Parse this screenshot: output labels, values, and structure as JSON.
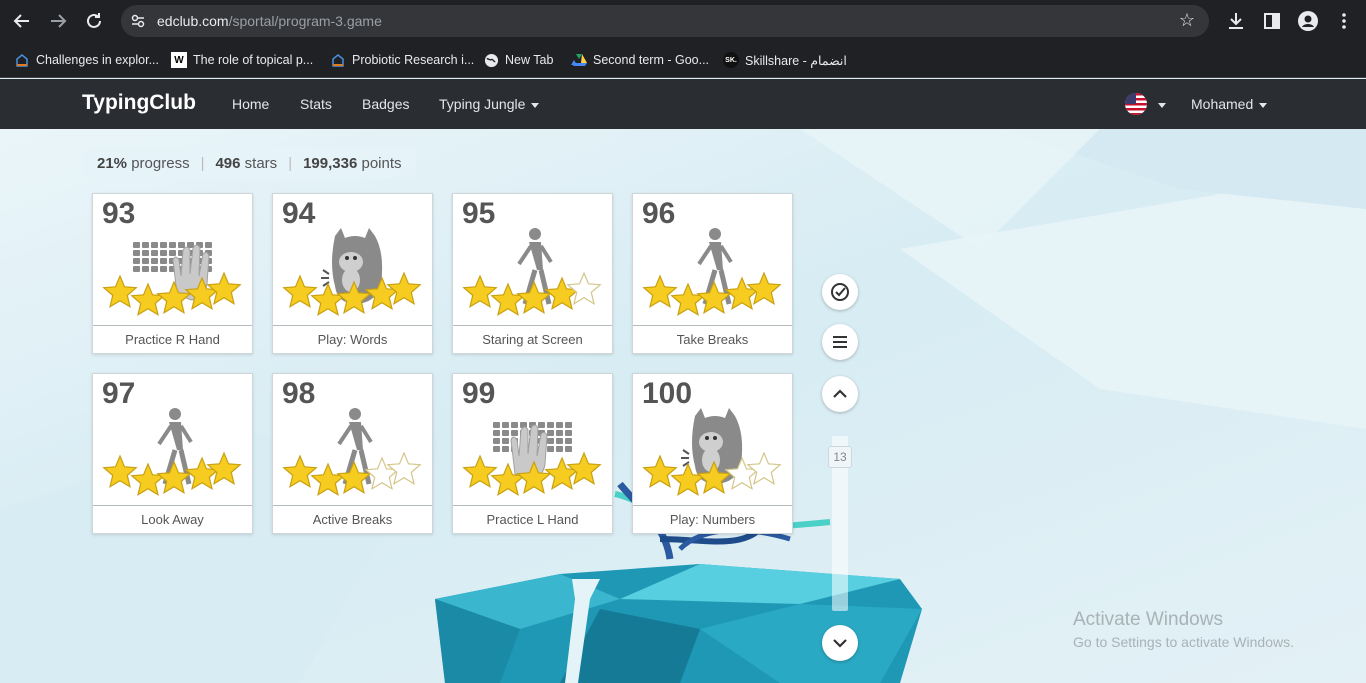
{
  "browser": {
    "url_host": "edclub.com",
    "url_path": "/sportal/program-3.game",
    "back_icon": "back-arrow-icon",
    "forward_icon": "forward-arrow-icon",
    "reload_icon": "reload-icon"
  },
  "bookmarks": [
    {
      "label": "Challenges in explor...",
      "icon": "page-icon"
    },
    {
      "label": "The role of topical p...",
      "icon": "wikipedia-icon"
    },
    {
      "label": "Probiotic Research i...",
      "icon": "page-icon"
    },
    {
      "label": "New Tab",
      "icon": "globe-icon"
    },
    {
      "label": "Second term - Goo...",
      "icon": "google-drive-icon"
    },
    {
      "label": "Skillshare - انضمام",
      "icon": "skillshare-icon"
    }
  ],
  "nav": {
    "brand": "TypingClub",
    "links": [
      "Home",
      "Stats",
      "Badges",
      "Typing Jungle"
    ],
    "user": "Mohamed"
  },
  "stats": {
    "progress_value": "21%",
    "progress_label": "progress",
    "stars_value": "496",
    "stars_label": "stars",
    "points_value": "199,336",
    "points_label": "points"
  },
  "lessons": [
    {
      "num": "93",
      "title": "Practice R Hand",
      "art": "keyboard-right-hand",
      "stars": 5
    },
    {
      "num": "94",
      "title": "Play: Words",
      "art": "game-creature",
      "stars": 5
    },
    {
      "num": "95",
      "title": "Staring at Screen",
      "art": "walking-person",
      "stars": 4
    },
    {
      "num": "96",
      "title": "Take Breaks",
      "art": "walking-person",
      "stars": 5
    },
    {
      "num": "97",
      "title": "Look Away",
      "art": "walking-person",
      "stars": 5
    },
    {
      "num": "98",
      "title": "Active Breaks",
      "art": "walking-person",
      "stars": 3
    },
    {
      "num": "99",
      "title": "Practice L Hand",
      "art": "keyboard-left-hand",
      "stars": 5
    },
    {
      "num": "100",
      "title": "Play: Numbers",
      "art": "game-creature",
      "stars": 3
    }
  ],
  "side": {
    "level": "13"
  },
  "watermark": {
    "line1": "Activate Windows",
    "line2": "Go to Settings to activate Windows."
  },
  "colors": {
    "chrome_bg": "#202124",
    "nav_bg": "#2a2d32",
    "star_gold": "#f5cc1f",
    "star_empty": "#ffffff"
  }
}
